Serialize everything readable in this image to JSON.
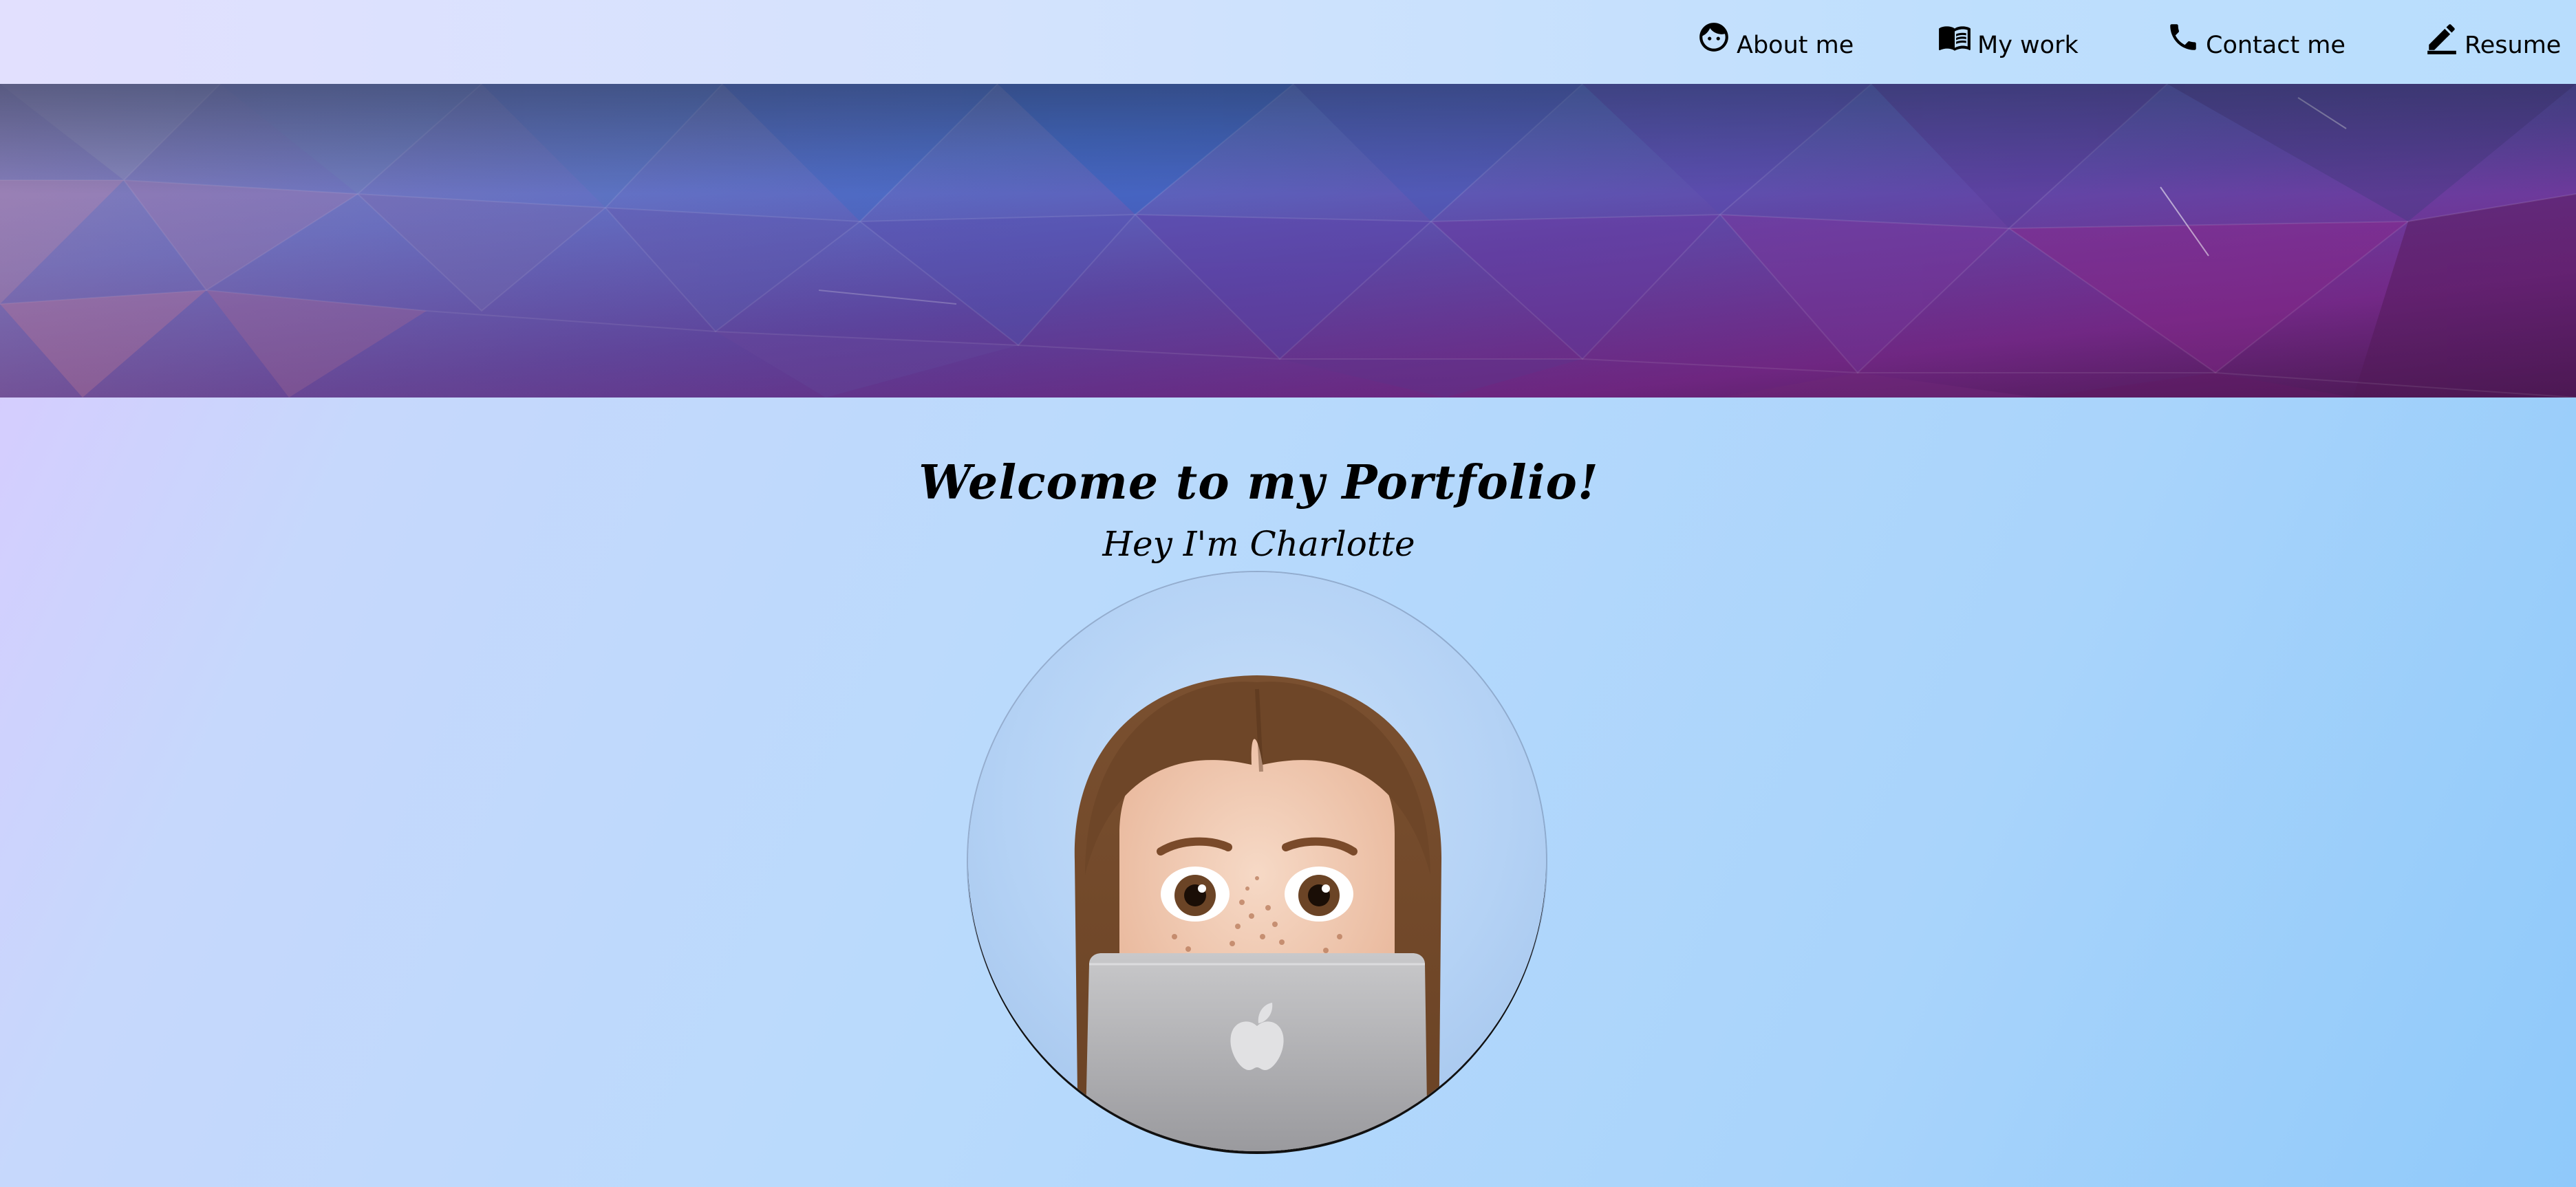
{
  "nav": {
    "items": [
      {
        "label": "About me",
        "icon": "face-icon"
      },
      {
        "label": "My work",
        "icon": "book-icon"
      },
      {
        "label": "Contact me",
        "icon": "phone-icon"
      },
      {
        "label": "Resume",
        "icon": "pencil-icon"
      }
    ]
  },
  "hero": {
    "title": "Welcome to my Portfolio!",
    "subtitle": "Hey I'm Charlotte",
    "avatar": "memoji-avatar-with-laptop"
  },
  "colors": {
    "banner_blue": "#3d6fc4",
    "banner_purple": "#7a2c8c",
    "text": "#000000"
  }
}
